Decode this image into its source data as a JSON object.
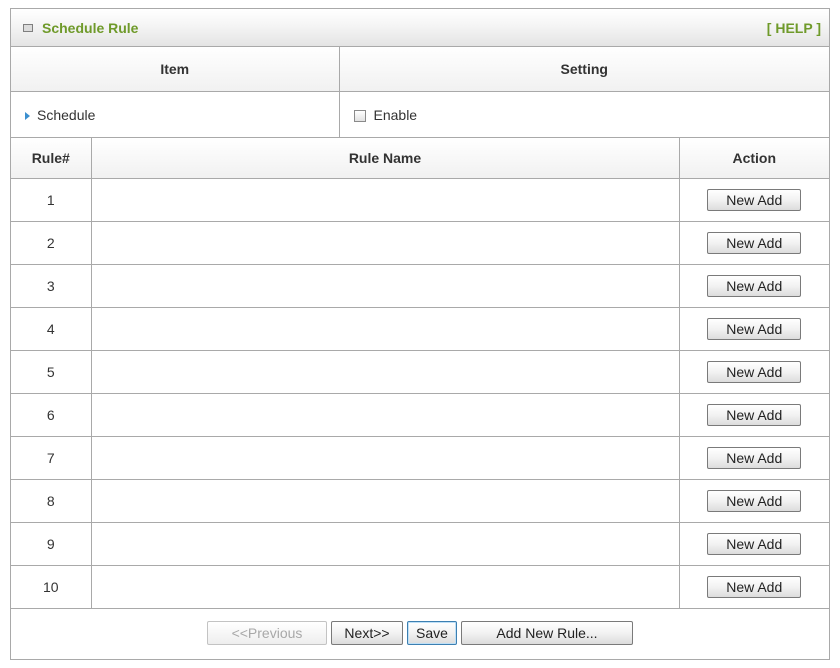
{
  "header": {
    "title": "Schedule Rule",
    "help": "[ HELP ]"
  },
  "settings_table": {
    "col_item": "Item",
    "col_setting": "Setting",
    "schedule_label": "Schedule",
    "enable_label": "Enable",
    "enable_checked": false
  },
  "rules_table": {
    "col_rule": "Rule#",
    "col_name": "Rule Name",
    "col_action": "Action",
    "rows": [
      {
        "num": "1",
        "name": "",
        "action": "New Add"
      },
      {
        "num": "2",
        "name": "",
        "action": "New Add"
      },
      {
        "num": "3",
        "name": "",
        "action": "New Add"
      },
      {
        "num": "4",
        "name": "",
        "action": "New Add"
      },
      {
        "num": "5",
        "name": "",
        "action": "New Add"
      },
      {
        "num": "6",
        "name": "",
        "action": "New Add"
      },
      {
        "num": "7",
        "name": "",
        "action": "New Add"
      },
      {
        "num": "8",
        "name": "",
        "action": "New Add"
      },
      {
        "num": "9",
        "name": "",
        "action": "New Add"
      },
      {
        "num": "10",
        "name": "",
        "action": "New Add"
      }
    ]
  },
  "footer": {
    "previous": "<<Previous",
    "next": "Next>>",
    "save": "Save",
    "add_new_rule": "Add New Rule..."
  },
  "colors": {
    "title_green": "#6f9a2a",
    "border": "#a9a9a9",
    "arrow_blue": "#3b8fcf"
  },
  "icons": {
    "title_icon": "square-bullet-icon",
    "schedule_marker": "triangle-right-icon",
    "enable_checkbox": "checkbox-icon"
  }
}
